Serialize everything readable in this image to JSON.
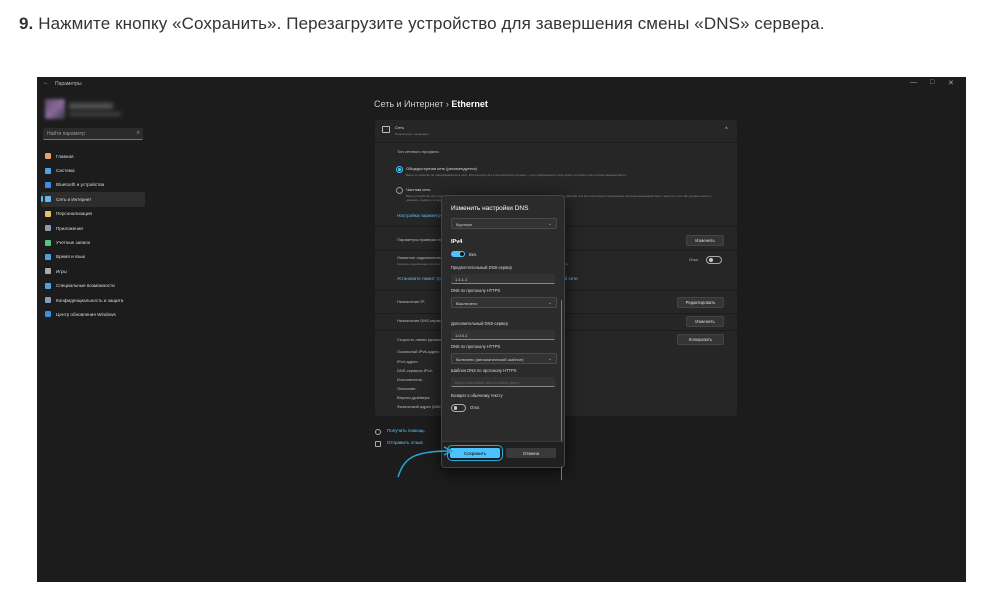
{
  "instruction": {
    "number": "9.",
    "text": "Нажмите кнопку «Сохранить». Перезагрузите устройство для завершения смены «DNS» сервера."
  },
  "window": {
    "title": "Параметры",
    "back": "←",
    "minimize": "—",
    "maximize": "□",
    "close": "✕"
  },
  "sidebar": {
    "search_placeholder": "Найти параметр",
    "search_icon": "⌕",
    "items": [
      {
        "label": "Главная",
        "icon": "home-icon",
        "color": "#e8a16b"
      },
      {
        "label": "Система",
        "icon": "system-icon",
        "color": "#4aa3e8"
      },
      {
        "label": "Bluetooth и устройства",
        "icon": "bluetooth-icon",
        "color": "#3c8ee0"
      },
      {
        "label": "Сеть и Интернет",
        "icon": "network-icon",
        "color": "#6db4e8"
      },
      {
        "label": "Персонализация",
        "icon": "brush-icon",
        "color": "#e8c06a"
      },
      {
        "label": "Приложения",
        "icon": "apps-icon",
        "color": "#8a9cb0"
      },
      {
        "label": "Учетные записи",
        "icon": "accounts-icon",
        "color": "#5cc28a"
      },
      {
        "label": "Время и язык",
        "icon": "clock-icon",
        "color": "#4aa3e8"
      },
      {
        "label": "Игры",
        "icon": "gamepad-icon",
        "color": "#aaaaaa"
      },
      {
        "label": "Специальные возможности",
        "icon": "accessibility-icon",
        "color": "#4aa3e8"
      },
      {
        "label": "Конфиденциальность и защита",
        "icon": "shield-icon",
        "color": "#8a9cb0"
      },
      {
        "label": "Центр обновления Windows",
        "icon": "update-icon",
        "color": "#3c8ee0"
      }
    ]
  },
  "breadcrumb": {
    "parent": "Сеть и Интернет",
    "separator": "›",
    "current": "Ethernet"
  },
  "card": {
    "header_title": "Сеть",
    "header_sub": "Подключено, защищено",
    "chevron": "^",
    "profile_label": "Тип сетевого профиля",
    "public_title": "Общедоступная сеть (рекомендуется)",
    "public_desc": "Ваше устройство не обнаруживается в сети. Используйте это в большинстве случаев — при подключении к сети дома, на работе или в общественном месте.",
    "private_title": "Частная сеть",
    "private_desc": "Ваше устройство доступно для обнаружения в сети. Выберите этот вариант, если вам необходим общий доступ к файлам или вы используете приложения, которые взаимодействуют через эту сеть. Вы должны знать и доверять людям и устройствам в сети.",
    "firewall_link": "Настройка параметров брандмауэра и безопасности",
    "auth_label": "Параметры проверки подлинности",
    "auth_button": "Изменить",
    "metered_title": "Лимитное подключение",
    "metered_desc": "Когда вы подключены к этой сети, некоторые приложения могут работать иначе, чтобы сократить использование трафика.",
    "metered_state": "Откл.",
    "data_limit_link": "Установите лимит трафика, чтобы контролировать использование данных в этой сети",
    "ip_label": "Назначение IP:",
    "ip_button": "Редактировать",
    "dns_label": "Назначение DNS-сервера:",
    "dns_button": "Изменить",
    "speed_label": "Скорость линии (прием/передача):",
    "ipv6_label": "Локальный IPv6-адрес:",
    "ipv4_label": "IPv4-адрес:",
    "dnsv4_label": "DNS-серверы IPv4:",
    "maker_label": "Изготовитель:",
    "desc_label": "Описание:",
    "driver_label": "Версия драйвера:",
    "mac_label": "Физический адрес (MAC):",
    "copy_button": "Копировать"
  },
  "help": {
    "help_link": "Получить помощь",
    "feedback_link": "Отправить отзыв"
  },
  "dialog": {
    "title": "Изменить настройки DNS",
    "mode": "Вручную",
    "ipv4_heading": "IPv4",
    "ipv4_toggle": "Вкл.",
    "preferred_label": "Предпочтительный DNS-сервер",
    "preferred_value": "1.1.1.1",
    "doh1_label": "DNS по протоколу HTTPS",
    "doh1_value": "Выключено",
    "alt_label": "Дополнительный DNS-сервер",
    "alt_value": "1.0.0.1",
    "doh2_label": "DNS по протоколу HTTPS",
    "doh2_value": "Включено (автоматический шаблон)",
    "template_label": "Шаблон DNS по протоколу HTTPS",
    "template_placeholder": "https://cloudflare-dns.com/dns-query",
    "fallback_label": "Возврат к обычному тексту",
    "fallback_state": "Откл.",
    "save": "Сохранить",
    "cancel": "Отмена",
    "chevron": "⌄"
  },
  "colors": {
    "accent": "#4cc2ff",
    "arrow": "#2aa7d8",
    "window_bg": "#1c1c1c",
    "card_bg": "#262626"
  }
}
